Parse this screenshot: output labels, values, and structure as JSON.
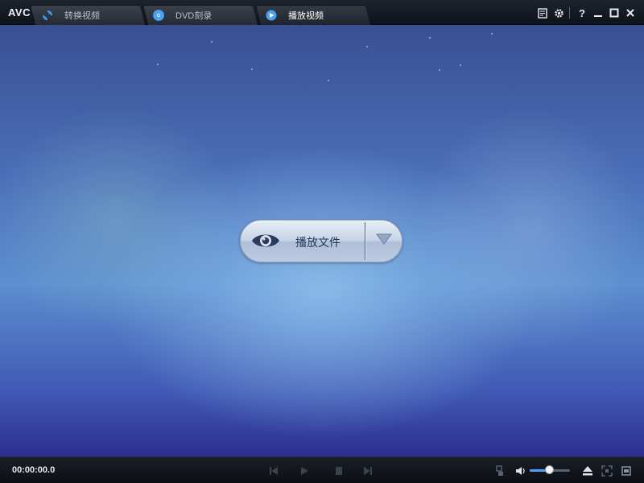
{
  "app": {
    "logo": "AVC"
  },
  "tabs": [
    {
      "label": "转换视频",
      "icon": "convert-icon",
      "active": false
    },
    {
      "label": "DVD刻录",
      "icon": "disc-icon",
      "active": false
    },
    {
      "label": "播放视频",
      "icon": "play-circle-icon",
      "active": true
    }
  ],
  "window_controls": [
    "log-icon",
    "gear-icon",
    "help-icon",
    "minimize-icon",
    "maximize-icon",
    "close-icon"
  ],
  "window_labels": {
    "help": "?"
  },
  "main": {
    "play_button": {
      "label": "播放文件",
      "icon": "eye-icon",
      "dropdown_icon": "triangle-down-icon"
    }
  },
  "player": {
    "time": "00:00:00.0",
    "controls": [
      "previous-icon",
      "play-icon",
      "stop-icon",
      "next-icon"
    ],
    "volume": 0.5,
    "right_controls": [
      "snapshot-icon",
      "volume-icon",
      "eject-icon",
      "fullscreen-icon",
      "film-icon"
    ]
  },
  "colors": {
    "accent": "#4da3ff",
    "play_icon_blue": "#2f86e0",
    "text_dark": "#243455"
  }
}
